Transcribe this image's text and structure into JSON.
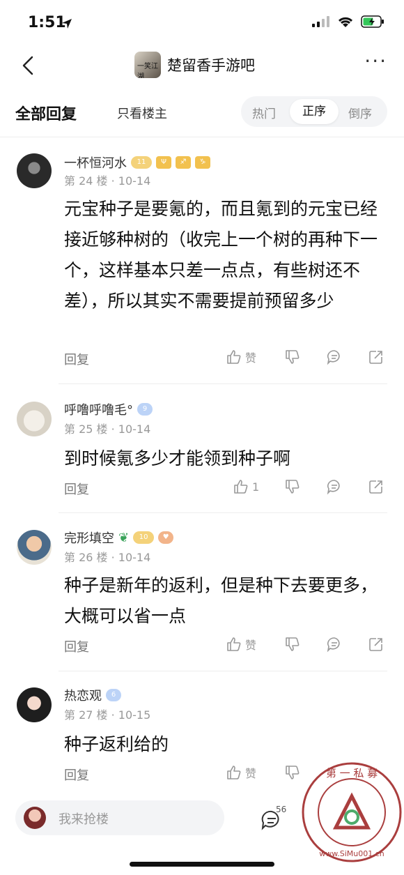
{
  "status_bar": {
    "time": "1:51"
  },
  "nav": {
    "forum_title": "楚留香手游吧",
    "forum_avatar_text": "一笑江湖",
    "more": "···"
  },
  "tabs": {
    "all": "全部回复",
    "op_only": "只看楼主",
    "sort_hot": "热门",
    "sort_asc": "正序",
    "sort_desc": "倒序"
  },
  "replies": [
    {
      "username": "一杯恒河水",
      "badges": [
        "11",
        "Ψ",
        "♐",
        "♑"
      ],
      "floor_date": "第 24 楼 · 10-14",
      "content": "元宝种子是要氪的，而且氪到的元宝已经接近够种树的（收完上一个树的再种下一个，这样基本只差一点点，有些树还不差），所以其实不需要提前预留多少",
      "reply_label": "回复",
      "like_label": "赞"
    },
    {
      "username": "呼噜呼噜毛°",
      "badges": [
        "9"
      ],
      "floor_date": "第 25 楼 · 10-14",
      "content": "到时候氪多少才能领到种子啊",
      "reply_label": "回复",
      "like_label": "1"
    },
    {
      "username": "完形填空",
      "badges": [
        "10"
      ],
      "floor_date": "第 26 楼 · 10-14",
      "content": "种子是新年的返利，但是种下去要更多，大概可以省一点",
      "reply_label": "回复",
      "like_label": "赞"
    },
    {
      "username": "热恋观",
      "badges": [
        "6"
      ],
      "floor_date": "第 27 楼 · 10-15",
      "content": "种子返利给的",
      "reply_label": "回复",
      "like_label": "赞"
    }
  ],
  "bottom_bar": {
    "input_placeholder": "我来抢楼",
    "comment_count": "56"
  },
  "watermark": {
    "text": "第一私募 www.SiMu001.cn"
  },
  "colors": {
    "accent_green": "#3aa35a",
    "level_gold": "#f4d27a",
    "level_blue": "#bcd3f7",
    "watermark_red": "#a12a2a"
  }
}
